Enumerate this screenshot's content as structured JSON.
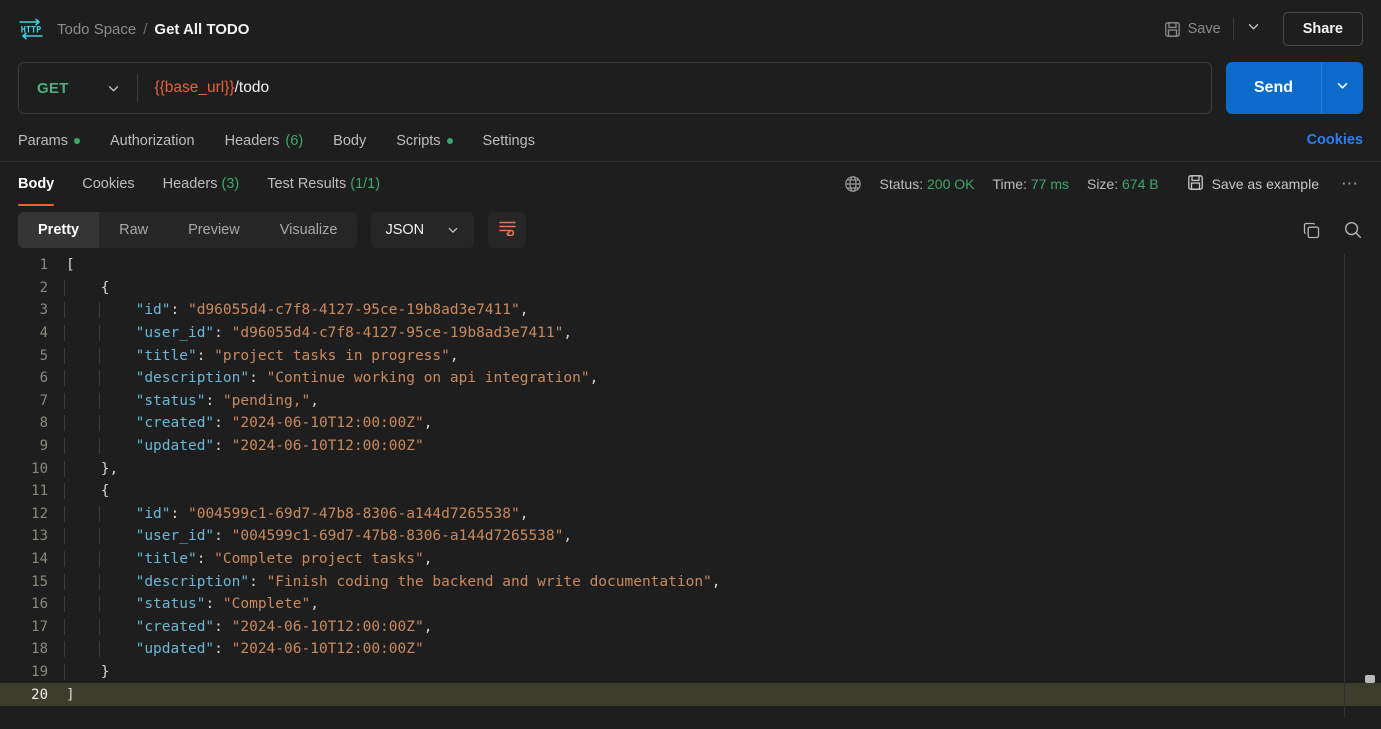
{
  "header": {
    "logo_icon": "http-icon",
    "breadcrumb": {
      "workspace": "Todo Space",
      "separator": "/",
      "request": "Get All TODO"
    },
    "save_label": "Save",
    "save_icon": "floppy-disk-icon",
    "save_dropdown_icon": "chevron-down-icon",
    "share_label": "Share"
  },
  "url_bar": {
    "method": "GET",
    "method_chevron_icon": "chevron-down-icon",
    "url_variable": "{{base_url}}",
    "url_path": "/todo",
    "send_label": "Send",
    "send_chevron_icon": "chevron-down-icon"
  },
  "request_tabs": [
    {
      "label": "Params",
      "dot": true
    },
    {
      "label": "Authorization",
      "dot": false
    },
    {
      "label": "Headers",
      "count": "(6)"
    },
    {
      "label": "Body",
      "dot": false
    },
    {
      "label": "Scripts",
      "dot": true
    },
    {
      "label": "Settings",
      "dot": false
    }
  ],
  "cookies_link": "Cookies",
  "response_tabs": [
    {
      "label": "Body",
      "active": true
    },
    {
      "label": "Cookies",
      "active": false
    },
    {
      "label": "Headers",
      "count": "(3)",
      "active": false
    },
    {
      "label": "Test Results",
      "count": "(1/1)",
      "active": false
    }
  ],
  "response_meta": {
    "globe_icon": "globe-icon",
    "status_label": "Status:",
    "status_value": "200 OK",
    "time_label": "Time:",
    "time_value": "77 ms",
    "size_label": "Size:",
    "size_value": "674 B",
    "save_example_label": "Save as example",
    "save_example_icon": "floppy-disk-icon",
    "more_icon": "ellipsis-icon"
  },
  "format_bar": {
    "views": [
      "Pretty",
      "Raw",
      "Preview",
      "Visualize"
    ],
    "active_view": "Pretty",
    "language": "JSON",
    "language_chevron_icon": "chevron-down-icon",
    "wrap_icon": "word-wrap-icon",
    "copy_icon": "copy-icon",
    "search_icon": "search-icon"
  },
  "code": {
    "highlight_line": 20,
    "lines": [
      {
        "n": 1,
        "indent": 0,
        "tokens": [
          {
            "t": "p",
            "v": "["
          }
        ]
      },
      {
        "n": 2,
        "indent": 1,
        "tokens": [
          {
            "t": "p",
            "v": "{"
          }
        ]
      },
      {
        "n": 3,
        "indent": 2,
        "tokens": [
          {
            "t": "k",
            "v": "\"id\""
          },
          {
            "t": "p",
            "v": ": "
          },
          {
            "t": "s",
            "v": "\"d96055d4-c7f8-4127-95ce-19b8ad3e7411\""
          },
          {
            "t": "p",
            "v": ","
          }
        ]
      },
      {
        "n": 4,
        "indent": 2,
        "tokens": [
          {
            "t": "k",
            "v": "\"user_id\""
          },
          {
            "t": "p",
            "v": ": "
          },
          {
            "t": "s",
            "v": "\"d96055d4-c7f8-4127-95ce-19b8ad3e7411\""
          },
          {
            "t": "p",
            "v": ","
          }
        ]
      },
      {
        "n": 5,
        "indent": 2,
        "tokens": [
          {
            "t": "k",
            "v": "\"title\""
          },
          {
            "t": "p",
            "v": ": "
          },
          {
            "t": "s",
            "v": "\"project tasks in progress\""
          },
          {
            "t": "p",
            "v": ","
          }
        ]
      },
      {
        "n": 6,
        "indent": 2,
        "tokens": [
          {
            "t": "k",
            "v": "\"description\""
          },
          {
            "t": "p",
            "v": ": "
          },
          {
            "t": "s",
            "v": "\"Continue working on api integration\""
          },
          {
            "t": "p",
            "v": ","
          }
        ]
      },
      {
        "n": 7,
        "indent": 2,
        "tokens": [
          {
            "t": "k",
            "v": "\"status\""
          },
          {
            "t": "p",
            "v": ": "
          },
          {
            "t": "s",
            "v": "\"pending,\""
          },
          {
            "t": "p",
            "v": ","
          }
        ]
      },
      {
        "n": 8,
        "indent": 2,
        "tokens": [
          {
            "t": "k",
            "v": "\"created\""
          },
          {
            "t": "p",
            "v": ": "
          },
          {
            "t": "s",
            "v": "\"2024-06-10T12:00:00Z\""
          },
          {
            "t": "p",
            "v": ","
          }
        ]
      },
      {
        "n": 9,
        "indent": 2,
        "tokens": [
          {
            "t": "k",
            "v": "\"updated\""
          },
          {
            "t": "p",
            "v": ": "
          },
          {
            "t": "s",
            "v": "\"2024-06-10T12:00:00Z\""
          }
        ]
      },
      {
        "n": 10,
        "indent": 1,
        "tokens": [
          {
            "t": "p",
            "v": "},"
          }
        ]
      },
      {
        "n": 11,
        "indent": 1,
        "tokens": [
          {
            "t": "p",
            "v": "{"
          }
        ]
      },
      {
        "n": 12,
        "indent": 2,
        "tokens": [
          {
            "t": "k",
            "v": "\"id\""
          },
          {
            "t": "p",
            "v": ": "
          },
          {
            "t": "s",
            "v": "\"004599c1-69d7-47b8-8306-a144d7265538\""
          },
          {
            "t": "p",
            "v": ","
          }
        ]
      },
      {
        "n": 13,
        "indent": 2,
        "tokens": [
          {
            "t": "k",
            "v": "\"user_id\""
          },
          {
            "t": "p",
            "v": ": "
          },
          {
            "t": "s",
            "v": "\"004599c1-69d7-47b8-8306-a144d7265538\""
          },
          {
            "t": "p",
            "v": ","
          }
        ]
      },
      {
        "n": 14,
        "indent": 2,
        "tokens": [
          {
            "t": "k",
            "v": "\"title\""
          },
          {
            "t": "p",
            "v": ": "
          },
          {
            "t": "s",
            "v": "\"Complete project tasks\""
          },
          {
            "t": "p",
            "v": ","
          }
        ]
      },
      {
        "n": 15,
        "indent": 2,
        "tokens": [
          {
            "t": "k",
            "v": "\"description\""
          },
          {
            "t": "p",
            "v": ": "
          },
          {
            "t": "s",
            "v": "\"Finish coding the backend and write documentation\""
          },
          {
            "t": "p",
            "v": ","
          }
        ]
      },
      {
        "n": 16,
        "indent": 2,
        "tokens": [
          {
            "t": "k",
            "v": "\"status\""
          },
          {
            "t": "p",
            "v": ": "
          },
          {
            "t": "s",
            "v": "\"Complete\""
          },
          {
            "t": "p",
            "v": ","
          }
        ]
      },
      {
        "n": 17,
        "indent": 2,
        "tokens": [
          {
            "t": "k",
            "v": "\"created\""
          },
          {
            "t": "p",
            "v": ": "
          },
          {
            "t": "s",
            "v": "\"2024-06-10T12:00:00Z\""
          },
          {
            "t": "p",
            "v": ","
          }
        ]
      },
      {
        "n": 18,
        "indent": 2,
        "tokens": [
          {
            "t": "k",
            "v": "\"updated\""
          },
          {
            "t": "p",
            "v": ": "
          },
          {
            "t": "s",
            "v": "\"2024-06-10T12:00:00Z\""
          }
        ]
      },
      {
        "n": 19,
        "indent": 1,
        "tokens": [
          {
            "t": "p",
            "v": "}"
          }
        ]
      },
      {
        "n": 20,
        "indent": 0,
        "tokens": [
          {
            "t": "p",
            "v": "]"
          }
        ]
      }
    ]
  },
  "colors": {
    "background": "#1e1e1e",
    "accent_orange": "#f0642c",
    "accent_blue": "#0b6bcb",
    "link_blue": "#2d7ff9",
    "success_green": "#3ea76a",
    "method_green": "#4caf7d",
    "json_key": "#6cb6d6",
    "json_string": "#c98a5e",
    "highlight_line": "#3d3d2b",
    "logo_cyan": "#3fd0e0"
  }
}
